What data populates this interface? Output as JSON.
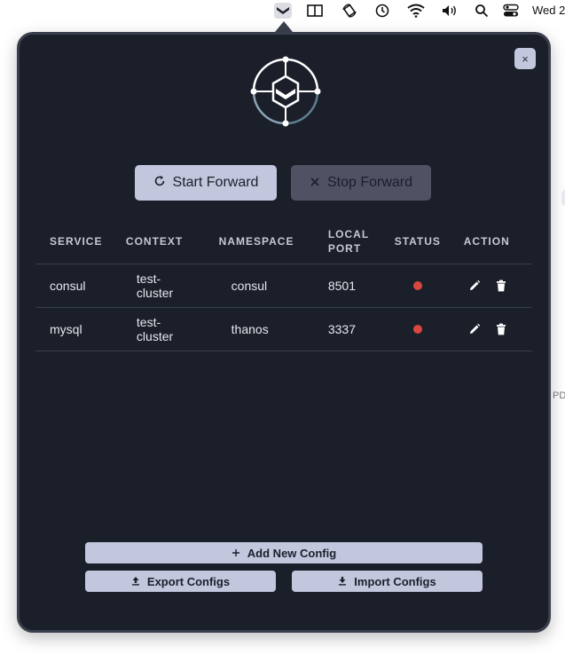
{
  "menubar": {
    "icons": [
      "app-logo-icon",
      "split-view-icon",
      "rotate-icon",
      "time-machine-icon",
      "wifi-icon",
      "volume-icon",
      "search-icon",
      "control-center-icon"
    ],
    "clock": "Wed 2"
  },
  "colors": {
    "panel_bg": "#1b1f2a",
    "button_primary": "#c3c7de",
    "button_disabled": "#4e5262",
    "status_stopped": "#d9473f"
  },
  "actions": {
    "start_label": "Start Forward",
    "stop_label": "Stop Forward",
    "close_label": "×"
  },
  "table": {
    "headers": {
      "service": "SERVICE",
      "context": "CONTEXT",
      "namespace": "NAMESPACE",
      "local_port": "LOCAL PORT",
      "status": "STATUS",
      "action": "ACTION"
    },
    "rows": [
      {
        "service": "consul",
        "context": "test-cluster",
        "namespace": "consul",
        "port": "8501",
        "status": "stopped"
      },
      {
        "service": "mysql",
        "context": "test-cluster",
        "namespace": "thanos",
        "port": "3337",
        "status": "stopped"
      }
    ]
  },
  "footer": {
    "add_label": "Add New Config",
    "export_label": "Export Configs",
    "import_label": "Import Configs"
  },
  "edge_text": "PD"
}
